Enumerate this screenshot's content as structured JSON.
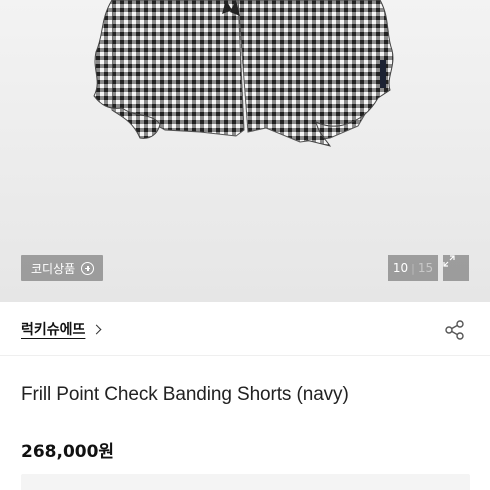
{
  "hero": {
    "image_icon": "shorts-photo",
    "coordi_label": "코디상품",
    "coordi_icon": "plus-circle-icon",
    "counter": {
      "current": "10",
      "separator": "|",
      "total": "15"
    },
    "expand_icon": "expand-icon"
  },
  "brand": {
    "name": "럭키슈에뜨",
    "chevron_icon": "chevron-right-icon"
  },
  "share_icon": "share-icon",
  "product": {
    "title": "Frill Point Check Banding Shorts (navy)",
    "price": "268,000원"
  },
  "colors": {
    "background": "#ffffff",
    "overlay": "#808080",
    "text": "#222222"
  }
}
